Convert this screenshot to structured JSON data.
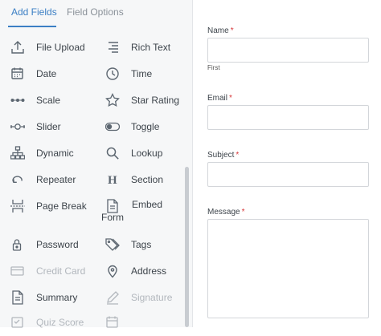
{
  "tabs": {
    "add_fields": "Add Fields",
    "field_options": "Field Options"
  },
  "fields": {
    "file_upload": "File Upload",
    "rich_text": "Rich Text",
    "date": "Date",
    "time": "Time",
    "scale": "Scale",
    "star_rating": "Star Rating",
    "slider": "Slider",
    "toggle": "Toggle",
    "dynamic": "Dynamic",
    "lookup": "Lookup",
    "repeater": "Repeater",
    "section": "Section",
    "page_break": "Page Break",
    "embed_form": "Embed Form",
    "password": "Password",
    "tags": "Tags",
    "credit_card": "Credit Card",
    "address": "Address",
    "summary": "Summary",
    "signature": "Signature",
    "quiz_score": "Quiz Score"
  },
  "form": {
    "name_label": "Name",
    "name_sublabel": "First",
    "email_label": "Email",
    "subject_label": "Subject",
    "message_label": "Message",
    "required_mark": "*"
  },
  "colors": {
    "accent": "#3b7fc4",
    "required": "#d63638",
    "disabled": "#b2b7bd"
  }
}
